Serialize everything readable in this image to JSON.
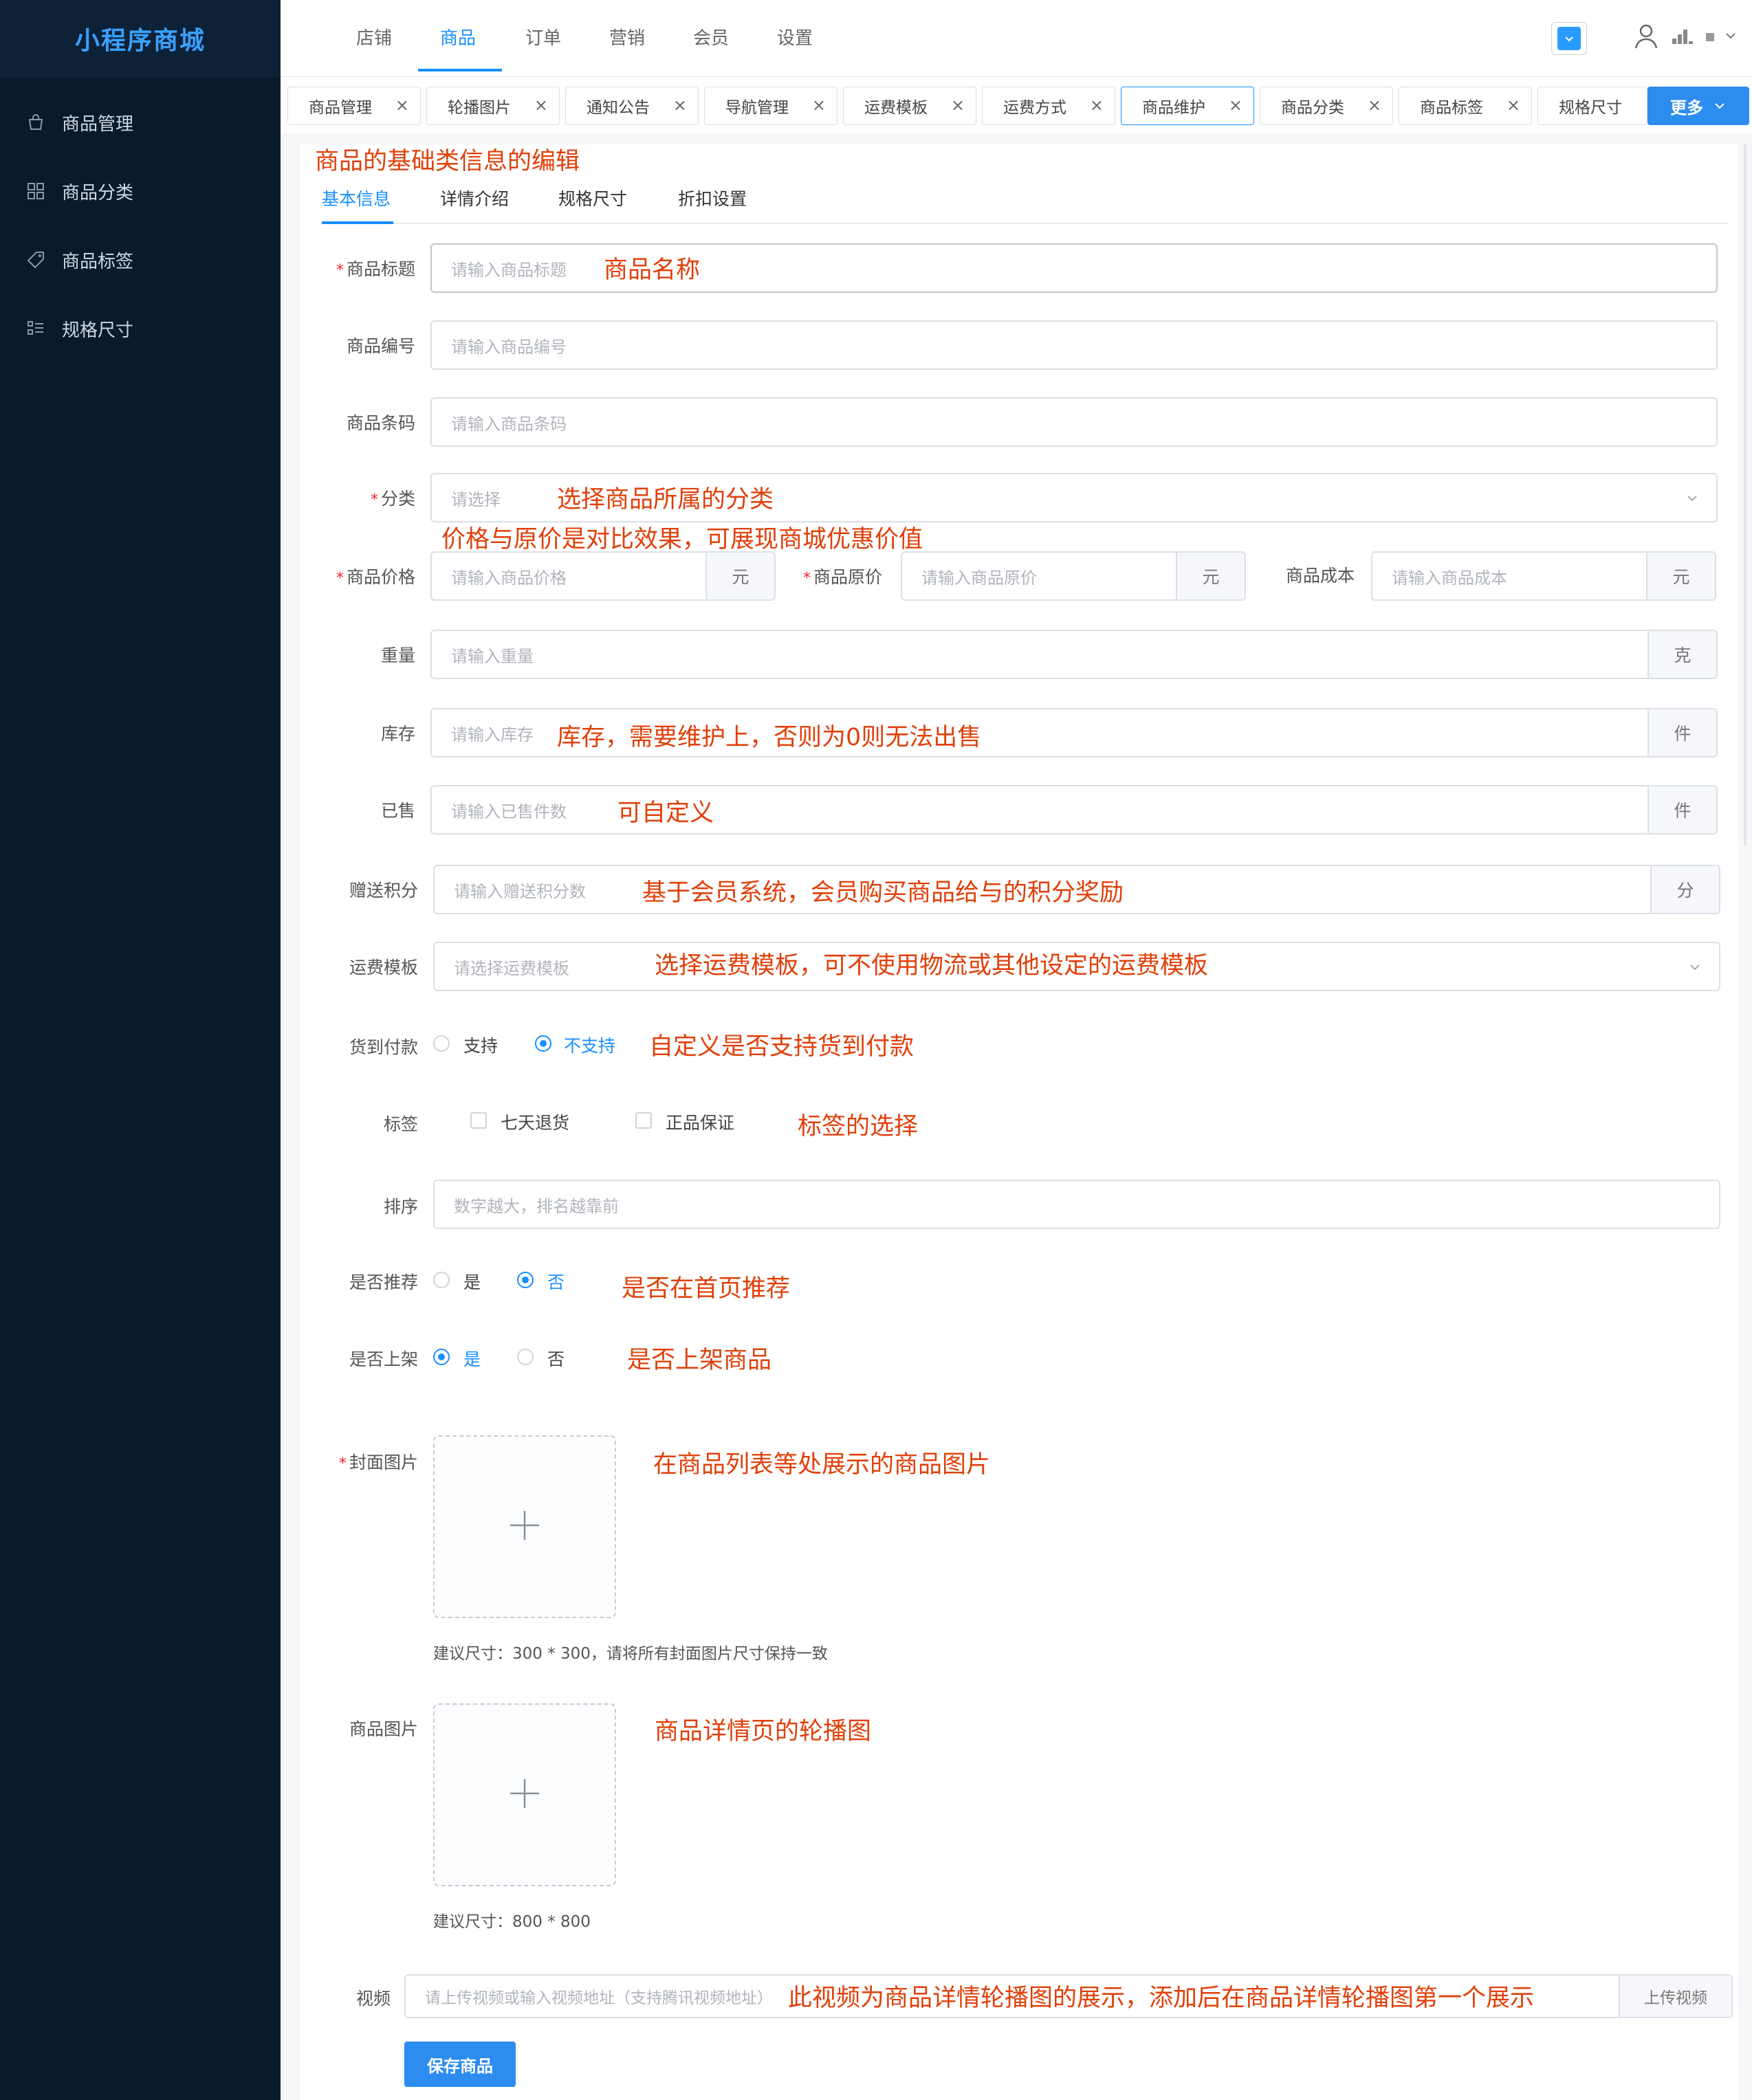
{
  "app": {
    "logo": "小程序商城"
  },
  "sidebar": {
    "items": [
      {
        "label": "商品管理",
        "icon": "shopping-bag-icon"
      },
      {
        "label": "商品分类",
        "icon": "category-grid-icon"
      },
      {
        "label": "商品标签",
        "icon": "tag-icon"
      },
      {
        "label": "规格尺寸",
        "icon": "spec-list-icon"
      }
    ]
  },
  "topnav": {
    "items": [
      "店铺",
      "商品",
      "订单",
      "营销",
      "会员",
      "设置"
    ],
    "active": "商品"
  },
  "tabs": {
    "items": [
      "商品管理",
      "轮播图片",
      "通知公告",
      "导航管理",
      "运费模板",
      "运费方式",
      "商品维护",
      "商品分类",
      "商品标签",
      "规格尺寸"
    ],
    "active": "商品维护",
    "close_symbol": "×",
    "more_label": "更多"
  },
  "annotations": {
    "header": "商品的基础类信息的编辑",
    "title": "商品名称",
    "category": "选择商品所属的分类",
    "price": "价格与原价是对比效果，可展现商城优惠价值",
    "stock": "库存，需要维护上，否则为0则无法出售",
    "sold": "可自定义",
    "points": "基于会员系统，会员购买商品给与的积分奖励",
    "shipping": "选择运费模板，可不使用物流或其他设定的运费模板",
    "cod": "自定义是否支持货到付款",
    "tags": "标签的选择",
    "recommend": "是否在首页推荐",
    "onsale": "是否上架商品",
    "cover": "在商品列表等处展示的商品图片",
    "images": "商品详情页的轮播图",
    "video": "此视频为商品详情轮播图的展示，添加后在商品详情轮播图第一个展示"
  },
  "subtabs": {
    "items": [
      "基本信息",
      "详情介绍",
      "规格尺寸",
      "折扣设置"
    ],
    "active": "基本信息"
  },
  "form": {
    "title": {
      "label": "商品标题",
      "placeholder": "请输入商品标题"
    },
    "code": {
      "label": "商品编号",
      "placeholder": "请输入商品编号"
    },
    "barcode": {
      "label": "商品条码",
      "placeholder": "请输入商品条码"
    },
    "category": {
      "label": "分类",
      "placeholder": "请选择"
    },
    "price": {
      "label": "商品价格",
      "placeholder": "请输入商品价格",
      "unit": "元"
    },
    "original_price": {
      "label": "商品原价",
      "placeholder": "请输入商品原价",
      "unit": "元"
    },
    "cost": {
      "label": "商品成本",
      "placeholder": "请输入商品成本",
      "unit": "元"
    },
    "weight": {
      "label": "重量",
      "placeholder": "请输入重量",
      "unit": "克"
    },
    "stock": {
      "label": "库存",
      "placeholder": "请输入库存",
      "unit": "件"
    },
    "sold": {
      "label": "已售",
      "placeholder": "请输入已售件数",
      "unit": "件"
    },
    "points": {
      "label": "赠送积分",
      "placeholder": "请输入赠送积分数",
      "unit": "分"
    },
    "shipping": {
      "label": "运费模板",
      "placeholder": "请选择运费模板"
    },
    "cod": {
      "label": "货到付款",
      "options": [
        "支持",
        "不支持"
      ],
      "selected": "不支持"
    },
    "tags": {
      "label": "标签",
      "options": [
        "七天退货",
        "正品保证"
      ],
      "checked": []
    },
    "sort": {
      "label": "排序",
      "placeholder": "数字越大，排名越靠前"
    },
    "recommend": {
      "label": "是否推荐",
      "options": [
        "是",
        "否"
      ],
      "selected": "否"
    },
    "onsale": {
      "label": "是否上架",
      "options": [
        "是",
        "否"
      ],
      "selected": "是"
    },
    "cover": {
      "label": "封面图片",
      "hint": "建议尺寸：300 * 300，请将所有封面图片尺寸保持一致"
    },
    "images": {
      "label": "商品图片",
      "hint": "建议尺寸：800 * 800"
    },
    "video": {
      "label": "视频",
      "placeholder": "请上传视频或输入视频地址（支持腾讯视频地址）",
      "button": "上传视频"
    },
    "save_label": "保存商品"
  },
  "colors": {
    "accent": "#1890ff",
    "sidebar_bg": "#0a1a2d",
    "annotation": "#e0400a",
    "required": "#f5222d"
  }
}
